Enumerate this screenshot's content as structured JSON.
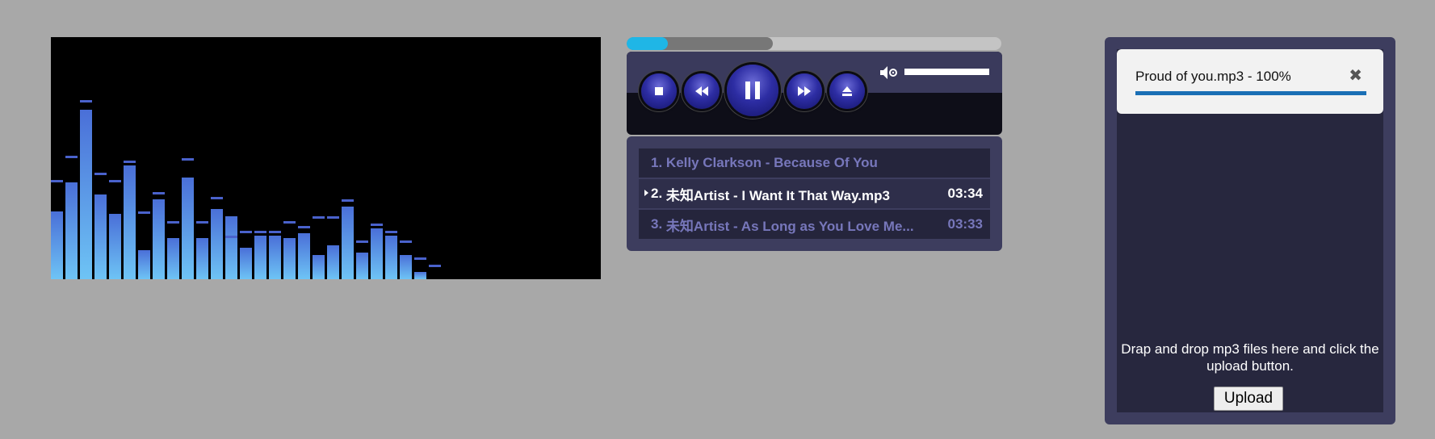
{
  "visualizer": {
    "bars": [
      0.28,
      0.4,
      0.7,
      0.35,
      0.27,
      0.47,
      0.12,
      0.33,
      0.17,
      0.42,
      0.17,
      0.29,
      0.26,
      0.13,
      0.18,
      0.18,
      0.17,
      0.19,
      0.1,
      0.14,
      0.3,
      0.11,
      0.21,
      0.18,
      0.1,
      0.03,
      0.0
    ],
    "peaks": [
      0.4,
      0.5,
      0.73,
      0.43,
      0.4,
      0.48,
      0.27,
      0.35,
      0.23,
      0.49,
      0.23,
      0.33,
      0.17,
      0.19,
      0.19,
      0.19,
      0.23,
      0.21,
      0.25,
      0.25,
      0.32,
      0.15,
      0.22,
      0.19,
      0.15,
      0.08,
      0.05
    ],
    "colors": {
      "bar_top": "#4a6fd8",
      "bar_bottom": "#6ec4f5",
      "peak": "#4a62cc"
    }
  },
  "player": {
    "progress": {
      "played": 0.11,
      "buffered": 0.39
    },
    "volume": 1.0,
    "buttons": [
      "stop-icon",
      "rewind-icon",
      "pause-icon",
      "fast-forward-icon",
      "eject-icon"
    ],
    "colors": {
      "accent": "#1fb6e6",
      "button": "#2d2da3"
    }
  },
  "playlist": {
    "tracks": [
      {
        "number": "1.",
        "title": "Kelly Clarkson - Because Of You",
        "duration": ""
      },
      {
        "number": "2.",
        "title": "未知Artist - I Want It That Way.mp3",
        "duration": "03:34",
        "active": true
      },
      {
        "number": "3.",
        "title": "未知Artist - As Long as You Love Me...",
        "duration": "03:33"
      }
    ]
  },
  "upload": {
    "file_label": "Proud of you.mp3 - 100%",
    "progress": 1.0,
    "close_glyph": "✖",
    "drop_text": "Drap and drop mp3 files here and click the upload button.",
    "button_label": "Upload"
  }
}
